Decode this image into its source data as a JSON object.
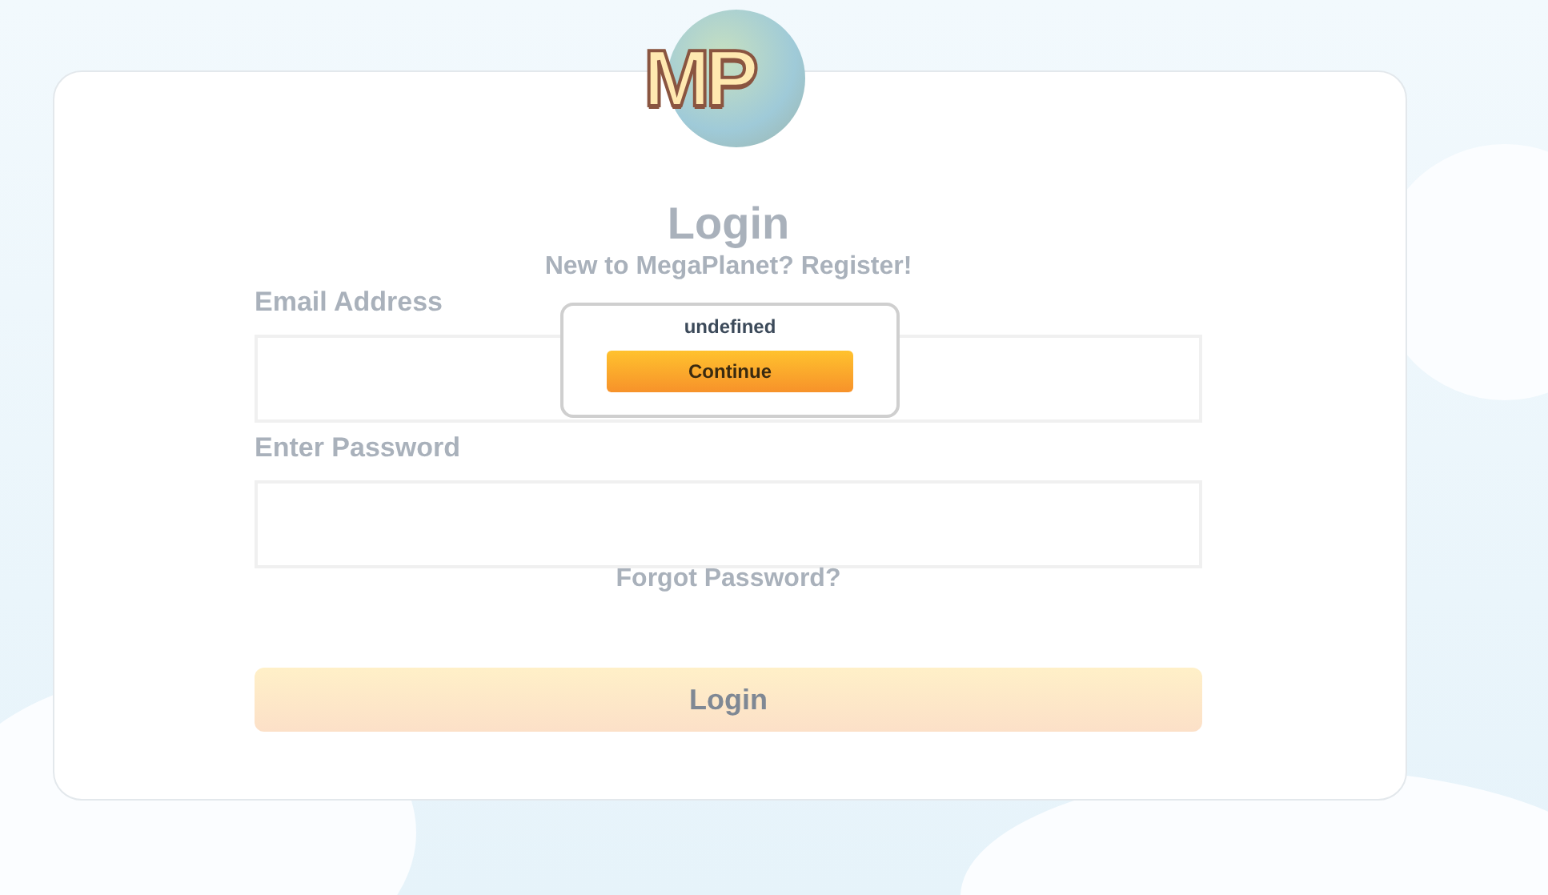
{
  "logo": {
    "text": "MP"
  },
  "form": {
    "title": "Login",
    "register_prompt": "New to MegaPlanet? Register!",
    "email_label": "Email Address",
    "password_label": "Enter Password",
    "forgot_link": "Forgot Password?",
    "submit": "Login"
  },
  "dialog": {
    "message": "undefined",
    "button": "Continue"
  }
}
